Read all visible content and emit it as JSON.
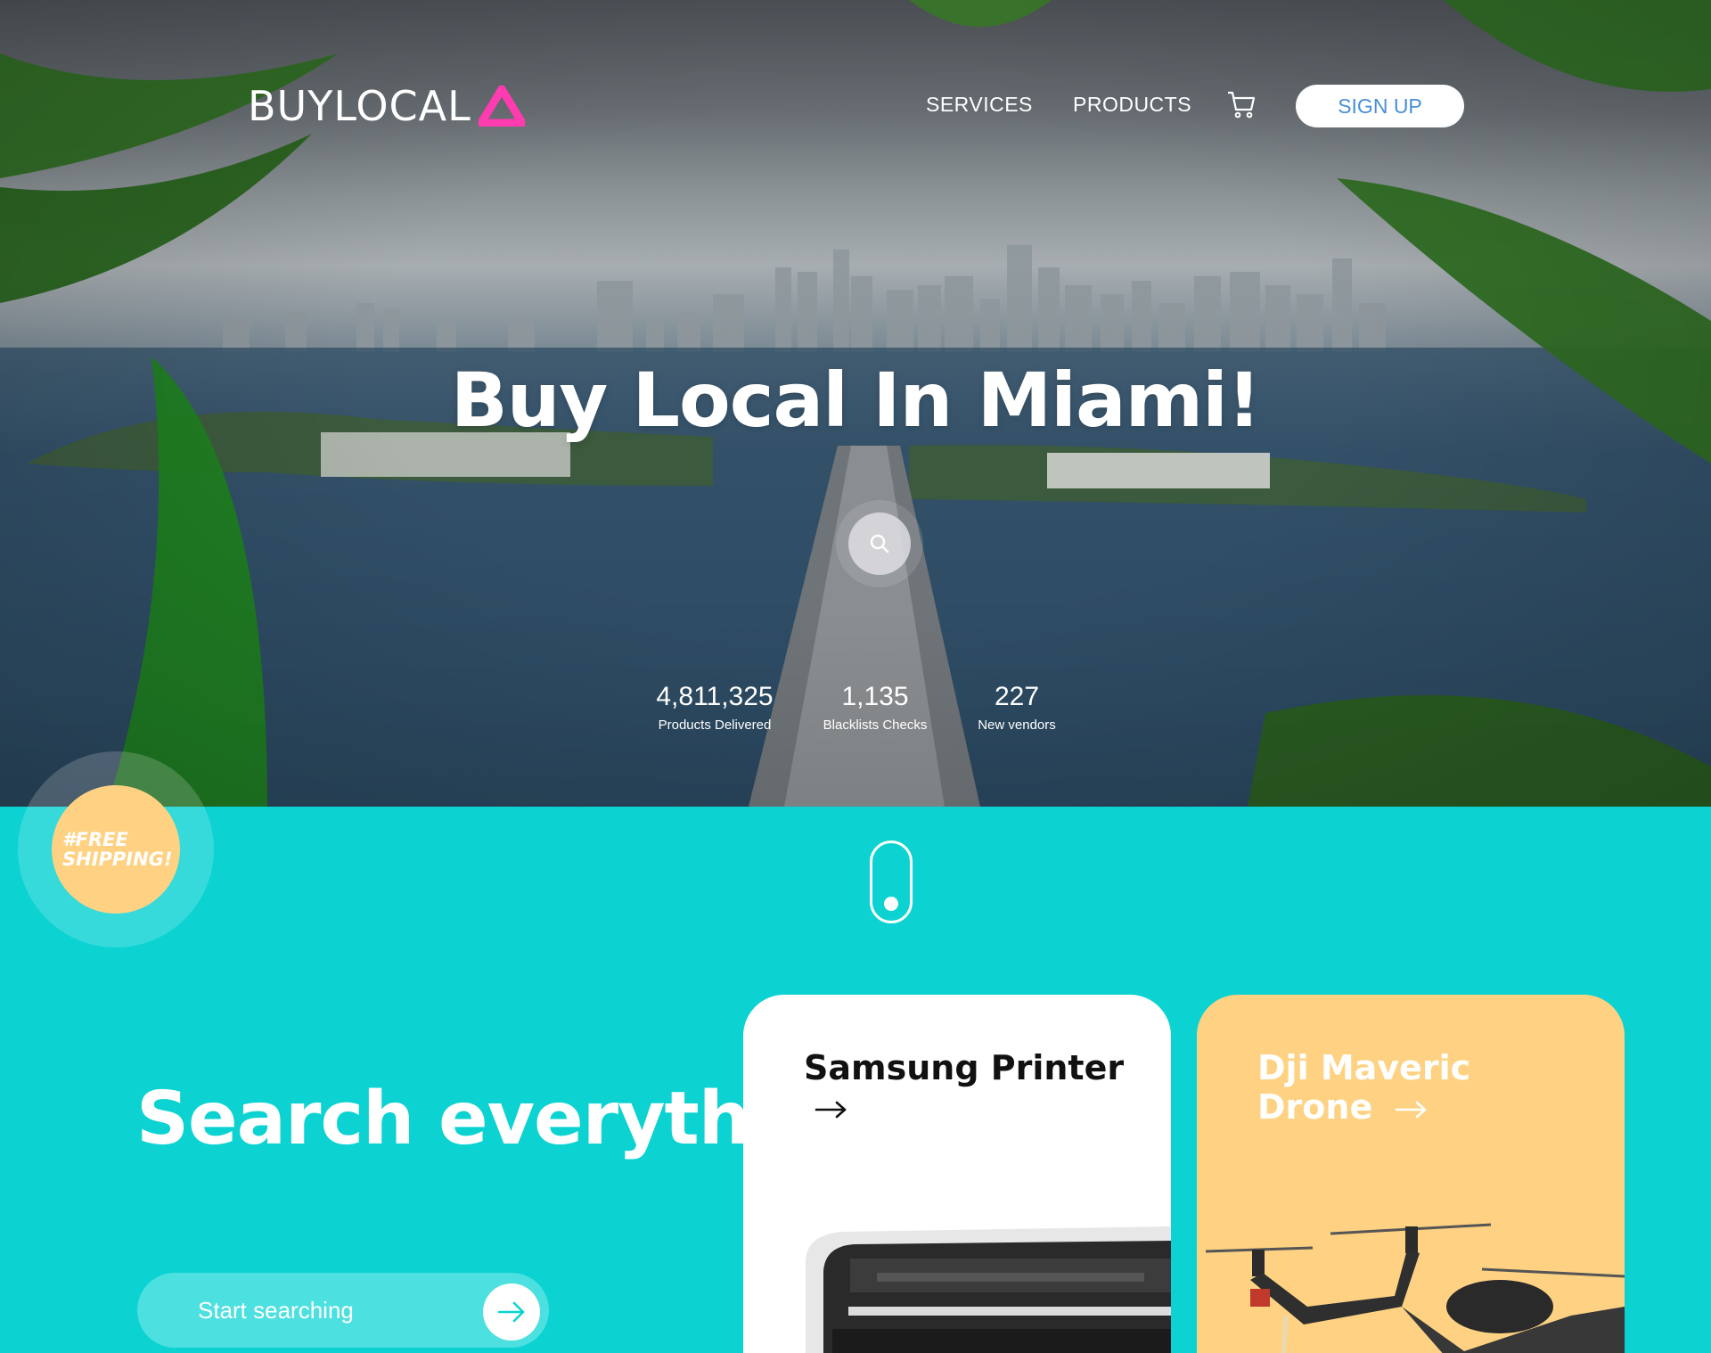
{
  "brand": {
    "name": "BUYLOCAL",
    "accent_color": "#ff3bb0"
  },
  "nav": {
    "services": "SERVICES",
    "products": "PRODUCTS",
    "cart_icon": "cart-icon",
    "signup": "SIGN UP"
  },
  "hero": {
    "title": "Buy Local In Miami!",
    "search_icon": "search-icon",
    "stats": [
      {
        "value": "4,811,325",
        "label": "Products Delivered"
      },
      {
        "value": "1,135",
        "label": "Blacklists Checks"
      },
      {
        "value": "227",
        "label": "New vendors"
      }
    ]
  },
  "badge": {
    "text": "#FREE SHIPPING!",
    "color": "#fed282"
  },
  "search": {
    "heading": "Search everything!",
    "placeholder": "Start searching",
    "submit_icon": "arrow-right-icon"
  },
  "products": [
    {
      "title": "Samsung Printer",
      "background": "#ffffff"
    },
    {
      "title": "Dji Maveric Drone",
      "background": "#fed282"
    }
  ],
  "colors": {
    "section_background": "#0cd2d2",
    "signup_text": "#4a8fd6"
  }
}
